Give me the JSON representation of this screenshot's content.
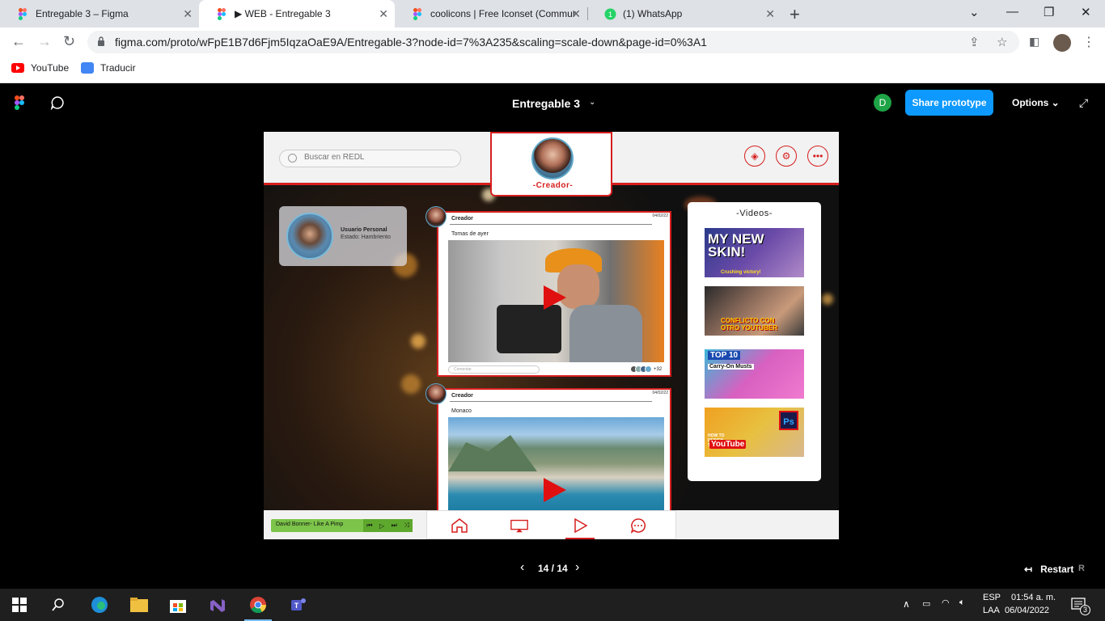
{
  "browser": {
    "tabs": [
      {
        "label": "Entregable 3 – Figma",
        "active": false
      },
      {
        "label": "▶ WEB - Entregable 3",
        "active": true
      },
      {
        "label": "coolicons | Free Iconset (Commun",
        "active": false
      },
      {
        "label": "(1) WhatsApp",
        "active": false
      }
    ],
    "url": "figma.com/proto/wFpE1B7d6Fjm5IqzaOaE9A/Entregable-3?node-id=7%3A235&scaling=scale-down&page-id=0%3A1",
    "bookmarks": [
      {
        "label": "YouTube"
      },
      {
        "label": "Traducir"
      }
    ]
  },
  "figma": {
    "file_title": "Entregable 3",
    "user_initial": "D",
    "share_label": "Share prototype",
    "options_label": "Options",
    "pager": "14 / 14",
    "restart_label": "Restart",
    "restart_key": "R"
  },
  "proto": {
    "search_placeholder": "Buscar en REDL",
    "creator_label": "-Creador-",
    "user": {
      "name": "Usuario Personal",
      "status": "Estado: Hambriento"
    },
    "posts": [
      {
        "author": "Creador",
        "date": "04/02/22",
        "caption": "Tomas de ayer",
        "comment_placeholder": "Comentar",
        "reaction_count": "+32"
      },
      {
        "author": "Creador",
        "date": "04/02/22",
        "caption": "Monaco"
      }
    ],
    "videos_title": "-Videos-",
    "thumbs": [
      {
        "text": "MY NEW SKIN!",
        "sub": "Crushing victory!"
      },
      {
        "text": "CONFLICTO CON OTRO YOUTUBER"
      },
      {
        "text": "TOP 10",
        "sub": "Carry-On Musts"
      },
      {
        "text": "YouTube",
        "sub": "HOW TO DESIGN THUMBNAILS"
      }
    ],
    "player_song": "David Bonner- Like A Pimp"
  },
  "taskbar": {
    "lang_top": "ESP",
    "lang_bottom": "LAA",
    "time": "01:54 a. m.",
    "date": "06/04/2022",
    "notif_count": "3"
  }
}
